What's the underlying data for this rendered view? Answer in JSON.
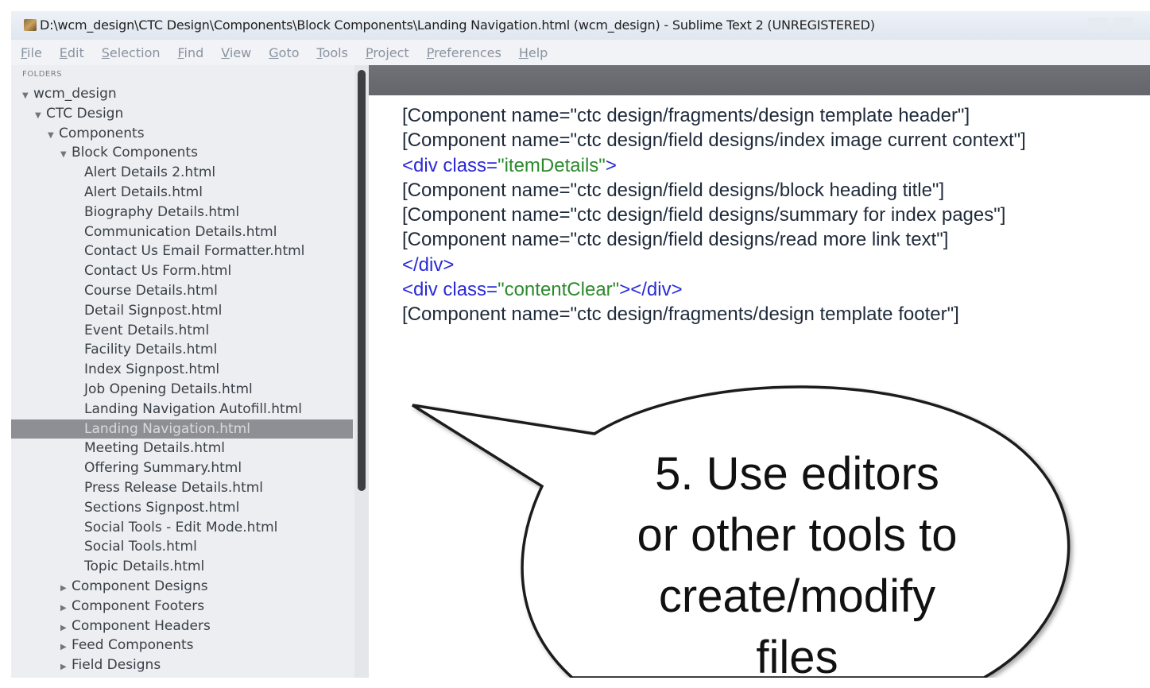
{
  "window": {
    "title": "D:\\wcm_design\\CTC Design\\Components\\Block Components\\Landing Navigation.html (wcm_design) - Sublime Text 2 (UNREGISTERED)"
  },
  "menu": [
    "File",
    "Edit",
    "Selection",
    "Find",
    "View",
    "Goto",
    "Tools",
    "Project",
    "Preferences",
    "Help"
  ],
  "sidebar": {
    "header": "FOLDERS",
    "tree": [
      {
        "label": "wcm_design",
        "depth": 0,
        "expander": "open"
      },
      {
        "label": "CTC Design",
        "depth": 1,
        "expander": "open"
      },
      {
        "label": "Components",
        "depth": 2,
        "expander": "open"
      },
      {
        "label": "Block Components",
        "depth": 3,
        "expander": "open"
      },
      {
        "label": "Alert Details 2.html",
        "depth": 4,
        "expander": "none"
      },
      {
        "label": "Alert Details.html",
        "depth": 4,
        "expander": "none"
      },
      {
        "label": "Biography Details.html",
        "depth": 4,
        "expander": "none"
      },
      {
        "label": "Communication Details.html",
        "depth": 4,
        "expander": "none"
      },
      {
        "label": "Contact Us Email Formatter.html",
        "depth": 4,
        "expander": "none"
      },
      {
        "label": "Contact Us Form.html",
        "depth": 4,
        "expander": "none"
      },
      {
        "label": "Course Details.html",
        "depth": 4,
        "expander": "none"
      },
      {
        "label": "Detail Signpost.html",
        "depth": 4,
        "expander": "none"
      },
      {
        "label": "Event Details.html",
        "depth": 4,
        "expander": "none"
      },
      {
        "label": "Facility Details.html",
        "depth": 4,
        "expander": "none"
      },
      {
        "label": "Index Signpost.html",
        "depth": 4,
        "expander": "none"
      },
      {
        "label": "Job Opening Details.html",
        "depth": 4,
        "expander": "none"
      },
      {
        "label": "Landing Navigation Autofill.html",
        "depth": 4,
        "expander": "none"
      },
      {
        "label": "Landing Navigation.html",
        "depth": 4,
        "expander": "none",
        "selected": true
      },
      {
        "label": "Meeting Details.html",
        "depth": 4,
        "expander": "none"
      },
      {
        "label": "Offering Summary.html",
        "depth": 4,
        "expander": "none"
      },
      {
        "label": "Press Release Details.html",
        "depth": 4,
        "expander": "none"
      },
      {
        "label": "Sections Signpost.html",
        "depth": 4,
        "expander": "none"
      },
      {
        "label": "Social Tools - Edit Mode.html",
        "depth": 4,
        "expander": "none"
      },
      {
        "label": "Social Tools.html",
        "depth": 4,
        "expander": "none"
      },
      {
        "label": "Topic Details.html",
        "depth": 4,
        "expander": "none"
      },
      {
        "label": "Component Designs",
        "depth": 3,
        "expander": "closed"
      },
      {
        "label": "Component Footers",
        "depth": 3,
        "expander": "closed"
      },
      {
        "label": "Component Headers",
        "depth": 3,
        "expander": "closed"
      },
      {
        "label": "Feed Components",
        "depth": 3,
        "expander": "closed"
      },
      {
        "label": "Field Designs",
        "depth": 3,
        "expander": "closed"
      }
    ]
  },
  "editor": {
    "lines": [
      [
        {
          "text": "[Component name=\"ctc design/fragments/design template header\"]",
          "kind": "plain"
        }
      ],
      [
        {
          "text": "[Component name=\"ctc design/field designs/index image current context\"]",
          "kind": "plain"
        }
      ],
      [
        {
          "text": "<div class=",
          "kind": "tag"
        },
        {
          "text": "\"itemDetails\"",
          "kind": "value"
        },
        {
          "text": ">",
          "kind": "tag"
        }
      ],
      [
        {
          "text": "[Component name=\"ctc design/field designs/block heading title\"]",
          "kind": "plain"
        }
      ],
      [
        {
          "text": "[Component name=\"ctc design/field designs/summary for index pages\"]",
          "kind": "plain"
        }
      ],
      [
        {
          "text": "[Component name=\"ctc design/field designs/read more link text\"]",
          "kind": "plain"
        }
      ],
      [
        {
          "text": "</div>",
          "kind": "tag"
        }
      ],
      [
        {
          "text": "<div class=",
          "kind": "tag"
        },
        {
          "text": "\"contentClear\"",
          "kind": "value"
        },
        {
          "text": "></div>",
          "kind": "tag"
        }
      ],
      [
        {
          "text": "[Component name=\"ctc design/fragments/design template footer\"]",
          "kind": "plain"
        }
      ]
    ]
  },
  "callout": {
    "lines": [
      "5. Use editors",
      "or other tools to",
      "create/modify",
      "files"
    ]
  },
  "colors": {
    "tag": "#2a2ad8",
    "value": "#2b8a2b",
    "plain": "#1f2a3a",
    "selection": "#8d8f94"
  }
}
